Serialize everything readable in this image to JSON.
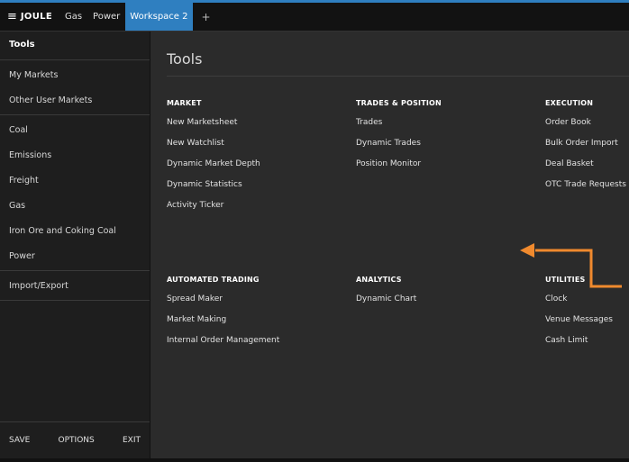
{
  "header": {
    "brand": "JOULE",
    "tabs": [
      {
        "label": "Gas"
      },
      {
        "label": "Power"
      },
      {
        "label": "Workspace 2"
      }
    ],
    "add_tab": "+"
  },
  "sidebar": {
    "title": "Tools",
    "groups": [
      [
        "My Markets",
        "Other User Markets"
      ],
      [
        "Coal",
        "Emissions",
        "Freight",
        "Gas",
        "Iron Ore and Coking Coal",
        "Power"
      ],
      [
        "Import/Export"
      ]
    ],
    "footer": {
      "save": "SAVE",
      "options": "OPTIONS",
      "exit": "EXIT"
    }
  },
  "main": {
    "title": "Tools",
    "sections": [
      {
        "heading": "MARKET",
        "items": [
          "New Marketsheet",
          "New Watchlist",
          "Dynamic Market Depth",
          "Dynamic Statistics",
          "Activity Ticker"
        ]
      },
      {
        "heading": "TRADES & POSITION",
        "items": [
          "Trades",
          "Dynamic Trades",
          "Position Monitor"
        ]
      },
      {
        "heading": "EXECUTION",
        "items": [
          "Order Book",
          "Bulk Order Import",
          "Deal Basket",
          "OTC Trade Requests"
        ]
      },
      {
        "heading": "AUTOMATED TRADING",
        "items": [
          "Spread Maker",
          "Market Making",
          "Internal Order Management"
        ]
      },
      {
        "heading": "ANALYTICS",
        "items": [
          "Dynamic Chart"
        ]
      },
      {
        "heading": "UTILITIES",
        "items": [
          "Clock",
          "Venue Messages",
          "Cash Limit"
        ]
      }
    ]
  },
  "colors": {
    "accent": "#2f7fc0",
    "annotation": "#f08a2e"
  }
}
